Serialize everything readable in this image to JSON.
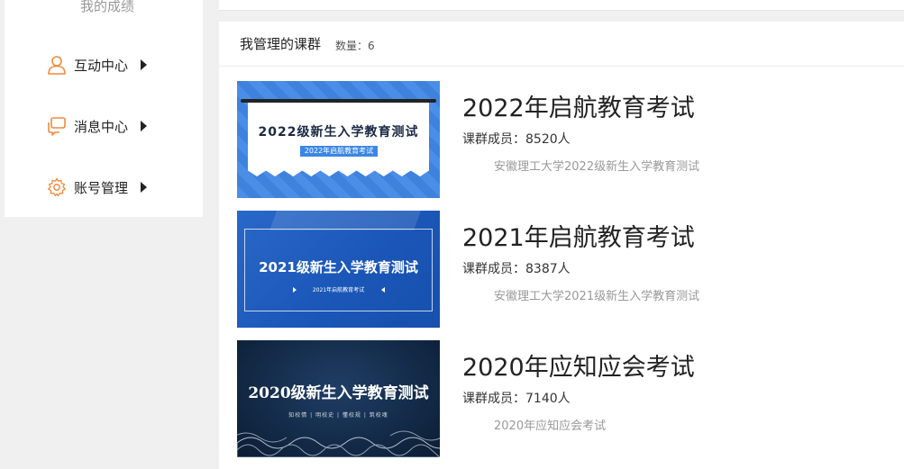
{
  "sidebar": {
    "top_label": "我的成绩",
    "items": [
      {
        "label": "互动中心",
        "icon": "user-icon"
      },
      {
        "label": "消息中心",
        "icon": "message-icon"
      },
      {
        "label": "账号管理",
        "icon": "gear-icon"
      }
    ]
  },
  "colors": {
    "accent": "#f08a3c",
    "thumb_blue": "#3f82de",
    "thumb_navy": "#132a47"
  },
  "main": {
    "title": "我管理的课群",
    "count": "数量：6",
    "groups": [
      {
        "title": "2022年启航教育考试",
        "members": "课群成员：8520人",
        "desc": "安徽理工大学2022级新生入学教育测试",
        "thumb_title": "2022级新生入学教育测试",
        "thumb_sub": "2022年启航教育考试"
      },
      {
        "title": "2021年启航教育考试",
        "members": "课群成员：8387人",
        "desc": "安徽理工大学2021级新生入学教育测试",
        "thumb_title": "2021级新生入学教育测试",
        "thumb_sub": "2021年启航教育考试"
      },
      {
        "title": "2020年应知应会考试",
        "members": "课群成员：7140人",
        "desc": "2020年应知应会考试",
        "thumb_title": "2020级新生入学教育测试",
        "thumb_sub": "知校情 | 明校史 | 懂校规 | 筑校魂"
      }
    ]
  }
}
